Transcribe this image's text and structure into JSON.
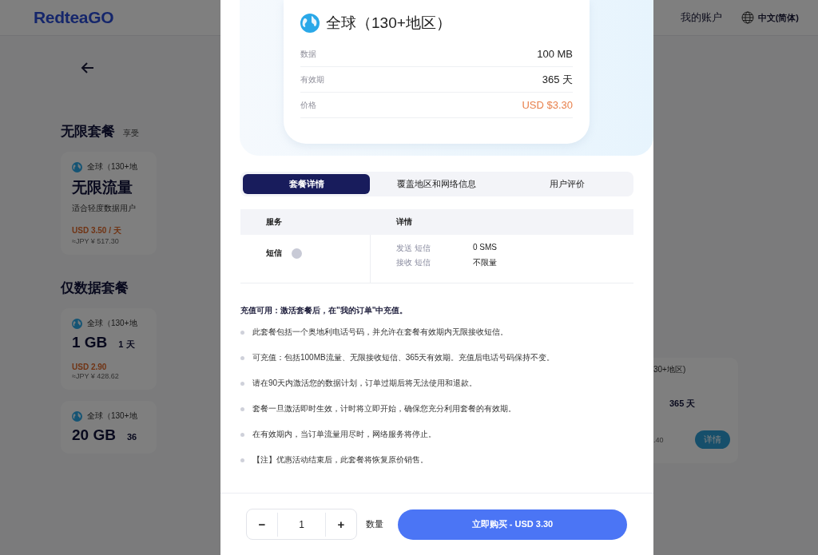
{
  "header": {
    "logo": "RedteaGO",
    "nav": [
      "我的账户"
    ],
    "language": "中文(简体)"
  },
  "background": {
    "sections": [
      {
        "title": "无限套餐",
        "subtitle": "享受",
        "cards": [
          {
            "region": "全球（130+地",
            "name": "无限流量",
            "desc": "适合轻度数据用户",
            "price": "USD 3.50 / 天",
            "approx": "≈JPY ¥ 517.30"
          }
        ]
      },
      {
        "title": "仅数据套餐",
        "cards": [
          {
            "region": "全球（130+地",
            "name": "1 GB",
            "days": "1 天",
            "price": "USD 2.90",
            "approx": "≈JPY ¥ 428.62"
          },
          {
            "region": "全球（130+地",
            "name": "20 GB",
            "days": "36"
          }
        ]
      }
    ],
    "right_card": {
      "region": "30+地区)",
      "days": "365 天",
      "approx": ".40",
      "button": "详情"
    }
  },
  "modal": {
    "plan": {
      "title": "全球（130+地区）",
      "rows": [
        {
          "label": "数据",
          "value": "100 MB",
          "kind": "plain"
        },
        {
          "label": "有效期",
          "value": "365 天",
          "kind": "plain"
        },
        {
          "label": "价格",
          "value": "USD $3.30",
          "kind": "price"
        }
      ]
    },
    "tabs": [
      {
        "label": "套餐详情",
        "selected": true
      },
      {
        "label": "覆盖地区和网络信息",
        "selected": false
      },
      {
        "label": "用户评价",
        "selected": false
      }
    ],
    "table": {
      "columns": [
        "服务",
        "详情"
      ],
      "rows": [
        {
          "service": "短信",
          "details": [
            {
              "label": "发送 短信",
              "value": "0 SMS"
            },
            {
              "label": "接收 短信",
              "value": "不限量"
            }
          ]
        }
      ]
    },
    "notes_title": "充值可用：激活套餐后，在\"我的订单\"中充值。",
    "notes": [
      "此套餐包括一个奥地利电话号码，并允许在套餐有效期内无限接收短信。",
      "可充值：包括100MB流量、无限接收短信、365天有效期。充值后电话号码保持不变。",
      "请在90天内激活您的数据计划，订单过期后将无法使用和退款。",
      "套餐一旦激活即时生效，计时将立即开始，确保您充分利用套餐的有效期。",
      "在有效期内，当订单流量用尽时，网络服务将停止。",
      "【注】优惠活动结束后，此套餐将恢复原价销售。"
    ],
    "quantity": {
      "minus": "−",
      "value": "1",
      "plus": "+",
      "label": "数量"
    },
    "buy_button": "立即购买 - USD 3.30"
  }
}
